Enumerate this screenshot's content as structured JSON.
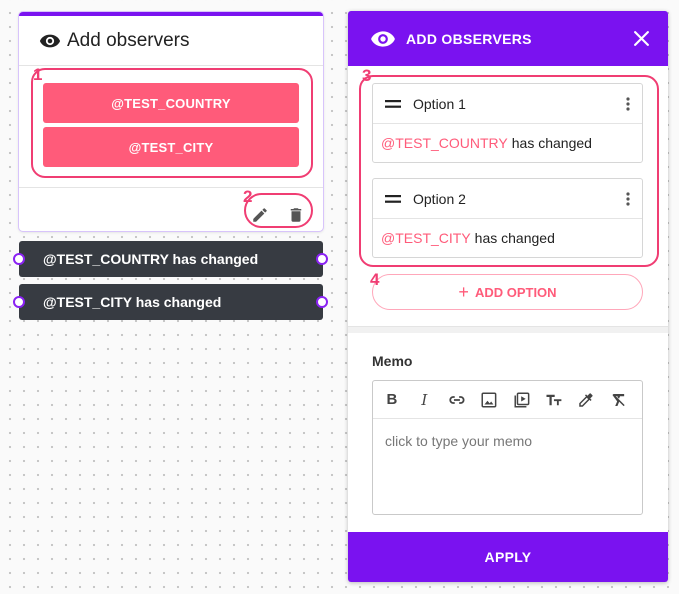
{
  "node": {
    "title": "Add observers",
    "buttons": [
      "@TEST_COUNTRY",
      "@TEST_CITY"
    ],
    "tools": [
      "pencil-icon",
      "trash-icon"
    ]
  },
  "outputs": [
    "@TEST_COUNTRY has changed",
    "@TEST_CITY has changed"
  ],
  "annotations": [
    "1",
    "2",
    "3",
    "4"
  ],
  "panel": {
    "title": "ADD OBSERVERS",
    "options": [
      {
        "name": "Option 1",
        "variable": "@TEST_COUNTRY",
        "text": "has changed"
      },
      {
        "name": "Option 2",
        "variable": "@TEST_CITY",
        "text": "has changed"
      }
    ],
    "add_option_label": "ADD OPTION",
    "memo_label": "Memo",
    "memo_placeholder": "click to type your memo",
    "memo_tools": [
      "bold",
      "italic",
      "link",
      "image",
      "video",
      "text-size",
      "color-picker",
      "clear-format"
    ],
    "apply_label": "APPLY"
  },
  "colors": {
    "accent": "#7a12f0",
    "pink": "#ff5b7a",
    "annotation": "#f03d73",
    "output_bg": "#373b42"
  }
}
